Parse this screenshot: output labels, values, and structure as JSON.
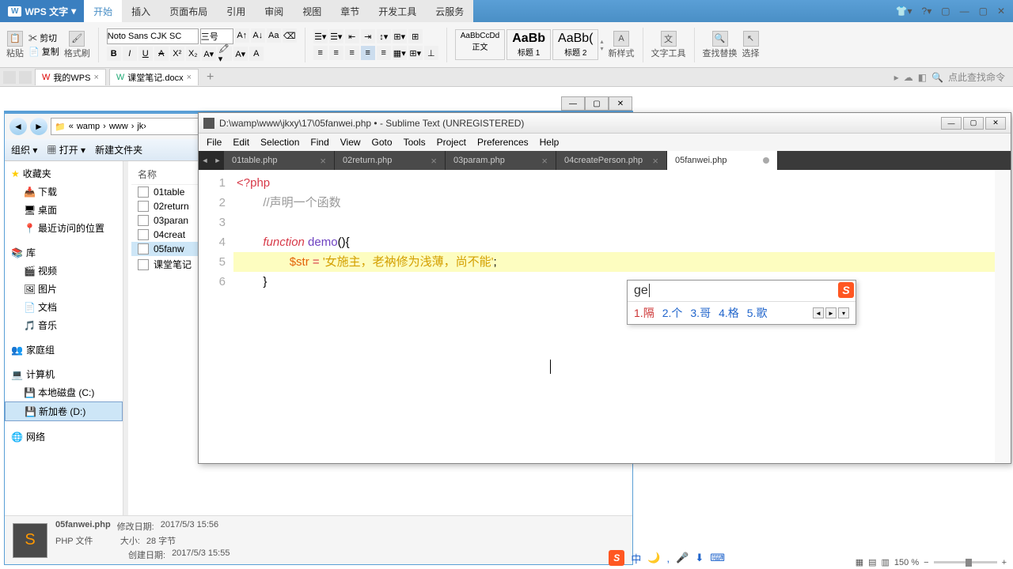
{
  "wps": {
    "logo_text": "WPS 文字",
    "menu_first": "▾",
    "menus": [
      "开始",
      "插入",
      "页面布局",
      "引用",
      "审阅",
      "视图",
      "章节",
      "开发工具",
      "云服务"
    ],
    "active_menu": 0,
    "clipboard": {
      "paste": "粘贴",
      "cut": "剪切",
      "copy": "复制",
      "brush": "格式刷"
    },
    "font_name": "Noto Sans CJK SC",
    "font_size": "三号",
    "bold": "B",
    "italic": "I",
    "underline": "U",
    "strike": "A",
    "styles": [
      {
        "preview": "AaBbCcDd",
        "name": "正文"
      },
      {
        "preview": "AaBb",
        "name": "标题 1"
      },
      {
        "preview": "AaBb(",
        "name": "标题 2"
      }
    ],
    "newstyle": "新样式",
    "texttool": "文字工具",
    "findreplace": "查找替换",
    "select": "选择",
    "doc_tabs": [
      {
        "icon": "W",
        "label": "我的WPS"
      },
      {
        "icon": "W",
        "label": "课堂笔记.docx"
      }
    ],
    "search_placeholder": "点此查找命令",
    "zoom": "150 %"
  },
  "explorer": {
    "breadcrumb": [
      "«",
      "wamp",
      "›",
      "www",
      "›",
      "jk›"
    ],
    "toolbar": {
      "organize": "组织 ▾",
      "open": "打开 ▾",
      "newfolder": "新建文件夹"
    },
    "sidebar": {
      "favorites": {
        "header": "收藏夹",
        "items": [
          "下载",
          "桌面",
          "最近访问的位置"
        ]
      },
      "libraries": {
        "header": "库",
        "items": [
          "视频",
          "图片",
          "文档",
          "音乐"
        ]
      },
      "homegroup": {
        "header": "家庭组"
      },
      "computer": {
        "header": "计算机",
        "items": [
          "本地磁盘 (C:)",
          "新加卷 (D:)"
        ]
      },
      "network": {
        "header": "网络"
      }
    },
    "content_header": "名称",
    "files": [
      "01table",
      "02return",
      "03paran",
      "04creat",
      "05fanw",
      "课堂笔记"
    ],
    "selected_file_index": 4,
    "status": {
      "name": "05fanwei.php",
      "type": "PHP 文件",
      "mod_label": "修改日期:",
      "mod_value": "2017/5/3 15:56",
      "size_label": "大小:",
      "size_value": "28 字节",
      "create_label": "创建日期:",
      "create_value": "2017/5/3 15:55"
    }
  },
  "sublime": {
    "title": "D:\\wamp\\www\\jkxy\\17\\05fanwei.php • - Sublime Text (UNREGISTERED)",
    "menus": [
      "File",
      "Edit",
      "Selection",
      "Find",
      "View",
      "Goto",
      "Tools",
      "Project",
      "Preferences",
      "Help"
    ],
    "tabs": [
      {
        "label": "01table.php",
        "active": false,
        "dirty": false
      },
      {
        "label": "02return.php",
        "active": false,
        "dirty": false
      },
      {
        "label": "03param.php",
        "active": false,
        "dirty": false
      },
      {
        "label": "04createPerson.php",
        "active": false,
        "dirty": false
      },
      {
        "label": "05fanwei.php",
        "active": true,
        "dirty": true
      }
    ],
    "lines": [
      "1",
      "2",
      "3",
      "4",
      "5",
      "6"
    ],
    "code": {
      "l1_tag": "<?php",
      "l2_comment": "//声明一个函数",
      "l4_kw": "function",
      "l4_name": " demo",
      "l4_paren": "(){",
      "l5_var": "$str",
      "l5_op": " = ",
      "l5_str": "'女施主，老衲修为浅薄，尚不能'",
      "l5_end": ";",
      "l6": "}"
    }
  },
  "ime": {
    "input": "ge",
    "candidates": [
      {
        "n": "1.",
        "c": "隔"
      },
      {
        "n": "2.",
        "c": "个"
      },
      {
        "n": "3.",
        "c": "哥"
      },
      {
        "n": "4.",
        "c": "格"
      },
      {
        "n": "5.",
        "c": "歌"
      }
    ]
  },
  "taskbar_ime": [
    "中",
    "🌙",
    ",",
    "🎤",
    "⬇",
    "⌨"
  ]
}
